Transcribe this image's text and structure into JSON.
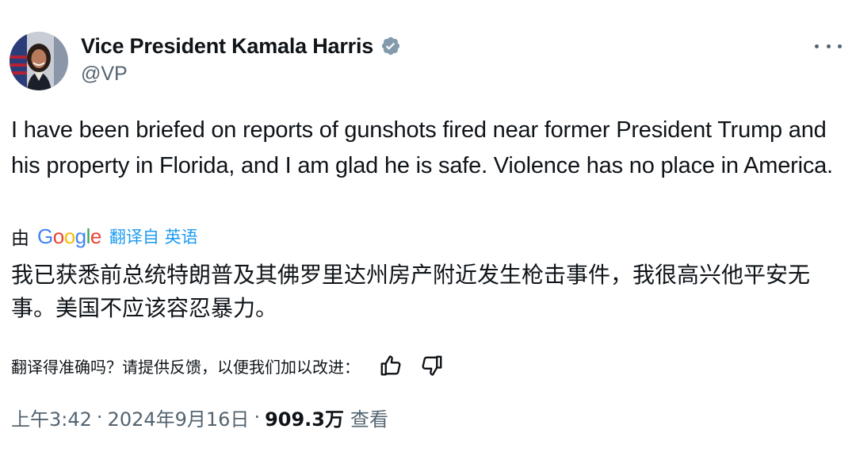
{
  "author": {
    "display_name": "Vice President Kamala Harris",
    "handle": "@VP",
    "verified": true,
    "verified_color": "#829aab"
  },
  "tweet": {
    "text": "I have been briefed on reports of gunshots fired near former President Trump and his property in Florida, and I am glad he is safe. Violence has no place in America."
  },
  "translation": {
    "by_label": "由",
    "provider": "Google",
    "source_label": "翻译自 英语",
    "text": "我已获悉前总统特朗普及其佛罗里达州房产附近发生枪击事件，我很高兴他平安无事。美国不应该容忍暴力。",
    "feedback_prompt": "翻译得准确吗？请提供反馈，以便我们加以改进：",
    "feedback_icons": [
      "thumbs-up-icon",
      "thumbs-down-icon"
    ]
  },
  "meta": {
    "time": "上午3:42",
    "date": "2024年9月16日",
    "views_count": "909.3万",
    "views_label": "查看"
  },
  "colors": {
    "text_primary": "#0f1419",
    "text_secondary": "#536471",
    "link_blue": "#1d9bf0"
  }
}
